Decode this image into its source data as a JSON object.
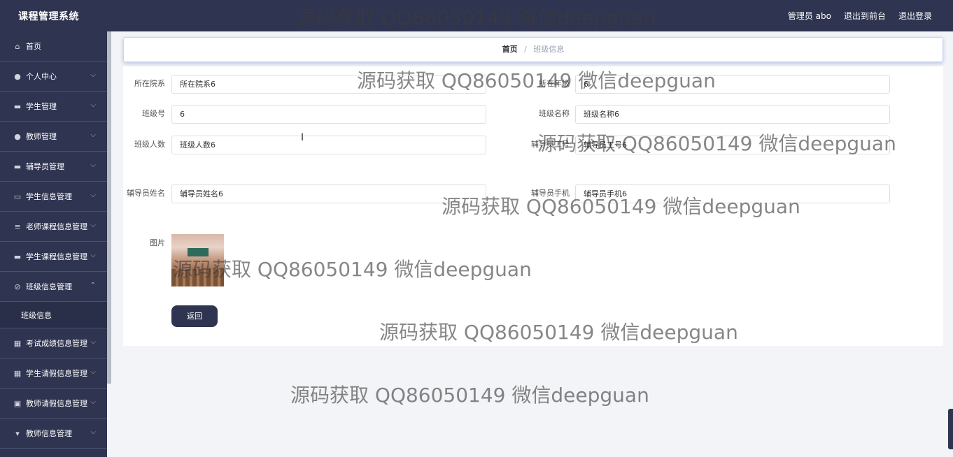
{
  "app": {
    "title": "课程管理系统",
    "user": "管理员 abo",
    "to_front": "退出到前台",
    "logout": "退出登录"
  },
  "sidebar": {
    "items": [
      {
        "label": "首页",
        "icon": "home-icon",
        "glyph": "⌂",
        "chevron": ""
      },
      {
        "label": "个人中心",
        "icon": "user-icon",
        "glyph": "●",
        "chevron": "⌵"
      },
      {
        "label": "学生管理",
        "icon": "card-icon",
        "glyph": "▬",
        "chevron": "⌵"
      },
      {
        "label": "教师管理",
        "icon": "user-icon",
        "glyph": "●",
        "chevron": "⌵"
      },
      {
        "label": "辅导员管理",
        "icon": "book-icon",
        "glyph": "▬",
        "chevron": "⌵"
      },
      {
        "label": "学生信息管理",
        "icon": "id-card-icon",
        "glyph": "▭",
        "chevron": "⌵"
      },
      {
        "label": "老师课程信息管理",
        "icon": "list-icon",
        "glyph": "≡",
        "chevron": "⌵"
      },
      {
        "label": "学生课程信息管理",
        "icon": "monitor-icon",
        "glyph": "▬",
        "chevron": "⌵"
      },
      {
        "label": "班级信息管理",
        "icon": "tag-icon",
        "glyph": "⊘",
        "chevron": "⌃"
      }
    ],
    "sub": {
      "label": "班级信息"
    },
    "items_after": [
      {
        "label": "考试成绩信息管理",
        "icon": "grid-icon",
        "glyph": "▦",
        "chevron": "⌵"
      },
      {
        "label": "学生请假信息管理",
        "icon": "grid-icon",
        "glyph": "▦",
        "chevron": "⌵"
      },
      {
        "label": "教师请假信息管理",
        "icon": "clipboard-icon",
        "glyph": "▣",
        "chevron": "⌵"
      },
      {
        "label": "教师信息管理",
        "icon": "trophy-icon",
        "glyph": "▾",
        "chevron": "⌵"
      }
    ]
  },
  "breadcrumb": {
    "home": "首页",
    "sep": "/",
    "current": "班级信息"
  },
  "form": {
    "department_label": "所在院系",
    "department_value": "所在院系6",
    "grade_label": "所在年级",
    "grade_value": "6",
    "class_no_label": "班级号",
    "class_no_value": "6",
    "class_name_label": "班级名称",
    "class_name_value": "班级名称6",
    "class_count_label": "班级人数",
    "class_count_value": "班级人数6",
    "counselor_no_label": "辅导员工号",
    "counselor_no_value": "辅导员工号6",
    "counselor_name_label": "辅导员姓名",
    "counselor_name_value": "辅导员姓名6",
    "counselor_phone_label": "辅导员手机",
    "counselor_phone_value": "辅导员手机6",
    "image_label": "图片",
    "back_label": "返回"
  },
  "watermark": "源码获取 QQ86050149 微信deepguan"
}
